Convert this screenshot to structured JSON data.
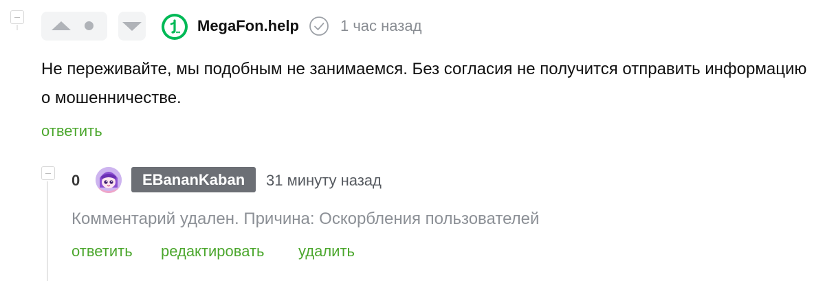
{
  "comment": {
    "author": "MegaFon.help",
    "verified": true,
    "time": "1 час назад",
    "text": "Не переживайте, мы подобным не занимаемся. Без согласия не получится отправить информацию о мошенничестве.",
    "reply_label": "ответить",
    "brand_color": "#00b956"
  },
  "reply": {
    "score": "0",
    "author": "EBananKaban",
    "time": "31 минуту назад",
    "text": "Комментарий удален. Причина: Оскорбления пользователей",
    "actions": {
      "reply": "ответить",
      "edit": "редактировать",
      "delete": "удалить"
    }
  },
  "colors": {
    "link": "#4ca72e",
    "muted": "#8c9096",
    "badge_bg": "#6c6f75"
  },
  "icons": {
    "upvote": "upvote-icon",
    "downvote": "downvote-icon",
    "verified": "check-circle-icon",
    "collapse": "minus-box-icon"
  }
}
